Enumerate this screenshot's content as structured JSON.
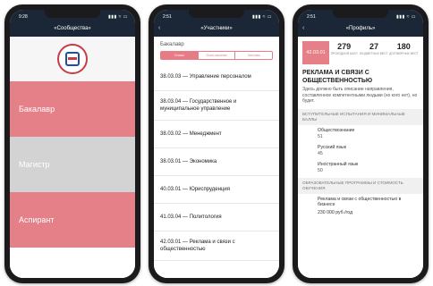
{
  "screen1": {
    "status_time": "9:28",
    "status_icons": "▮▮▮ ≈ ▭",
    "nav_title": "«Сообщества»",
    "levels": [
      {
        "label": "Бакалавр"
      },
      {
        "label": "Магистр"
      },
      {
        "label": "Аспирант"
      }
    ]
  },
  "screen2": {
    "status_time": "2:51",
    "status_icons": "▮▮▮ ≈ ▭",
    "nav_back": "‹",
    "nav_title": "«Участники»",
    "section_label": "Бакалавр",
    "segments": [
      {
        "label": "Очная"
      },
      {
        "label": "Очно-заочная"
      },
      {
        "label": "Заочная"
      }
    ],
    "programs": [
      {
        "label": "38.03.03 — Управление персоналом"
      },
      {
        "label": "38.03.04 — Государственное и муниципальное управление"
      },
      {
        "label": "38.03.02 — Менеджмент"
      },
      {
        "label": "38.03.01 — Экономика"
      },
      {
        "label": "40.03.01 — Юриспруденция"
      },
      {
        "label": "41.03.04 — Политология"
      },
      {
        "label": "42.03.01 — Реклама и связи с общественностью"
      }
    ]
  },
  "screen3": {
    "status_time": "2:51",
    "status_icons": "▮▮▮ ≈ ▭",
    "nav_back": "‹",
    "nav_title": "«Профиль»",
    "code": "42.03.01",
    "stats": [
      {
        "value": "279",
        "label": "ПРОХОДНОЙ БАЛЛ"
      },
      {
        "value": "27",
        "label": "БЮДЖЕТНЫХ МЕСТ"
      },
      {
        "value": "180",
        "label": "ДОГОВОРНЫХ МЕСТ"
      }
    ],
    "title": "РЕКЛАМА И СВЯЗИ С ОБЩЕСТВЕННОСТЬЮ",
    "description": "Здесь должно быть описание направления, составленное компетентными людьми (но кого нет), но будет.",
    "exams_header": "ВСТУПИТЕЛЬНЫЕ ИСПЫТАНИЯ И МИНИМАЛЬНЫЕ БАЛЛЫ",
    "exams": [
      {
        "subject": "Обществознание",
        "score": "51"
      },
      {
        "subject": "Русский язык",
        "score": "45"
      },
      {
        "subject": "Иностранный язык",
        "score": "50"
      }
    ],
    "programs_header": "ОБРАЗОВАТЕЛЬНЫЕ ПРОГРАММЫ И СТОИМОСТЬ ОБУЧЕНИЯ",
    "program": {
      "name": "Реклама и связи с общественностью в бизнесе",
      "price": "230 000 руб./год"
    }
  },
  "colors": {
    "navbar": "#1b2737",
    "accent": "#e57f88",
    "grey_block": "#d3d3d3"
  }
}
